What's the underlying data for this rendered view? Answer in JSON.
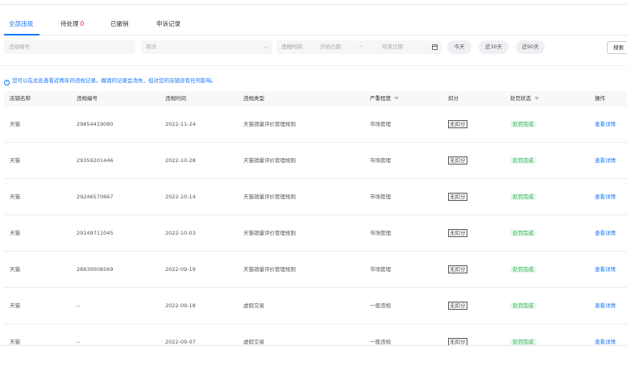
{
  "tabs": [
    {
      "label": "全部违规",
      "badge": ""
    },
    {
      "label": "待处理",
      "badge": "0"
    },
    {
      "label": "已撤销",
      "badge": ""
    },
    {
      "label": "申诉记录",
      "badge": ""
    }
  ],
  "filters": {
    "violation_no_placeholder": "违规编号",
    "type_placeholder": "商详",
    "time_label": "违规时间",
    "start_placeholder": "开始日期",
    "range_sep": "~",
    "end_placeholder": "结束日期",
    "quick": [
      "今天",
      "近30天",
      "近90天"
    ],
    "search_label": "搜索"
  },
  "notice": "您可以在此处查看近两年的违规记录。撤销的记录会消失，但对您的店铺没有任何影响。",
  "table": {
    "columns": [
      "店铺名称",
      "违规编号",
      "违规时间",
      "违规类型",
      "严重程度",
      "扣分",
      "处罚状态",
      "操作"
    ],
    "rows": [
      {
        "shop": "天猫",
        "no": "29854419080",
        "time": "2022-11-24",
        "type": "天猫销量评价管理规则",
        "severity": "市场管理",
        "points": "无扣分",
        "status": "处罚完成",
        "action": "查看详情"
      },
      {
        "shop": "天猫",
        "no": "29359201446",
        "time": "2022-10-28",
        "type": "天猫销量评价管理规则",
        "severity": "市场管理",
        "points": "无扣分",
        "status": "处罚完成",
        "action": "查看详情"
      },
      {
        "shop": "天猫",
        "no": "29246570667",
        "time": "2022-10-14",
        "type": "天猫销量评价管理规则",
        "severity": "市场管理",
        "points": "无扣分",
        "status": "处罚完成",
        "action": "查看详情"
      },
      {
        "shop": "天猫",
        "no": "29149711045",
        "time": "2022-10-03",
        "type": "天猫销量评价管理规则",
        "severity": "市场管理",
        "points": "无扣分",
        "status": "处罚完成",
        "action": "查看详情"
      },
      {
        "shop": "天猫",
        "no": "28830008569",
        "time": "2022-09-19",
        "type": "天猫销量评价管理规则",
        "severity": "市场管理",
        "points": "无扣分",
        "status": "处罚完成",
        "action": "查看详情"
      },
      {
        "shop": "天猫",
        "no": "--",
        "time": "2022-09-18",
        "type": "虚假交易",
        "severity": "一般违规",
        "points": "无扣分",
        "status": "处罚完成",
        "action": "查看详情"
      },
      {
        "shop": "天猫",
        "no": "--",
        "time": "2022-09-07",
        "type": "虚假交易",
        "severity": "一般违规",
        "points": "无扣分",
        "status": "处罚完成",
        "action": "查看详情"
      }
    ]
  },
  "colors": {
    "accent": "#1677ff",
    "success": "#34b55a",
    "badge": "#f5222d"
  }
}
